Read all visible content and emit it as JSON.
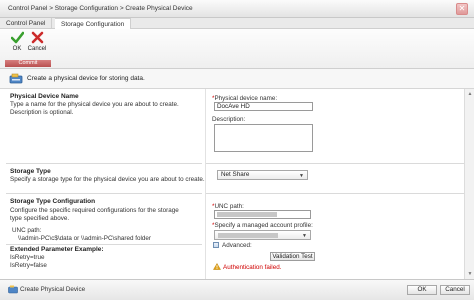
{
  "breadcrumb": "Control Panel  >  Storage Configuration  >  Create Physical Device",
  "tabs": [
    "Control Panel",
    "Storage Configuration"
  ],
  "ribbon": {
    "ok_label": "OK",
    "cancel_label": "Cancel",
    "group_label": "Commit"
  },
  "info_text": "Create a physical device for storing data.",
  "sections": {
    "name": {
      "title": "Physical Device Name",
      "description": "Type a name for the physical device you are about to create. Description is optional."
    },
    "type": {
      "title": "Storage Type",
      "description": "Specify a storage type for the physical device you are about to create."
    },
    "config": {
      "title": "Storage Type Configuration",
      "description": "Configure the specific required configurations for the storage type specified above.",
      "unc_title": "UNC path:",
      "unc_example": "\\\\admin-PC\\c$\\data or \\\\admin-PC\\shared folder",
      "ext_title": "Extended Parameter Example:",
      "ext_lines": [
        "IsRetry=true",
        "IsRetry=false"
      ]
    }
  },
  "form": {
    "device_name_label": "Physical device name:",
    "device_name_value": "DocAve HD",
    "description_label": "Description:",
    "storage_type_value": "Net Share",
    "unc_label": "UNC path:",
    "account_label": "Specify a managed account profile:",
    "advanced_label": "Advanced:",
    "validation_label": "Validation Test",
    "error_text": "Authentication failed."
  },
  "footer": {
    "title": "Create Physical Device",
    "ok_label": "OK",
    "cancel_label": "Cancel"
  },
  "colors": {
    "error": "#d00000",
    "commit": "#b95050",
    "ok_check": "#3aa02f",
    "cancel_x": "#cc2b2b"
  }
}
